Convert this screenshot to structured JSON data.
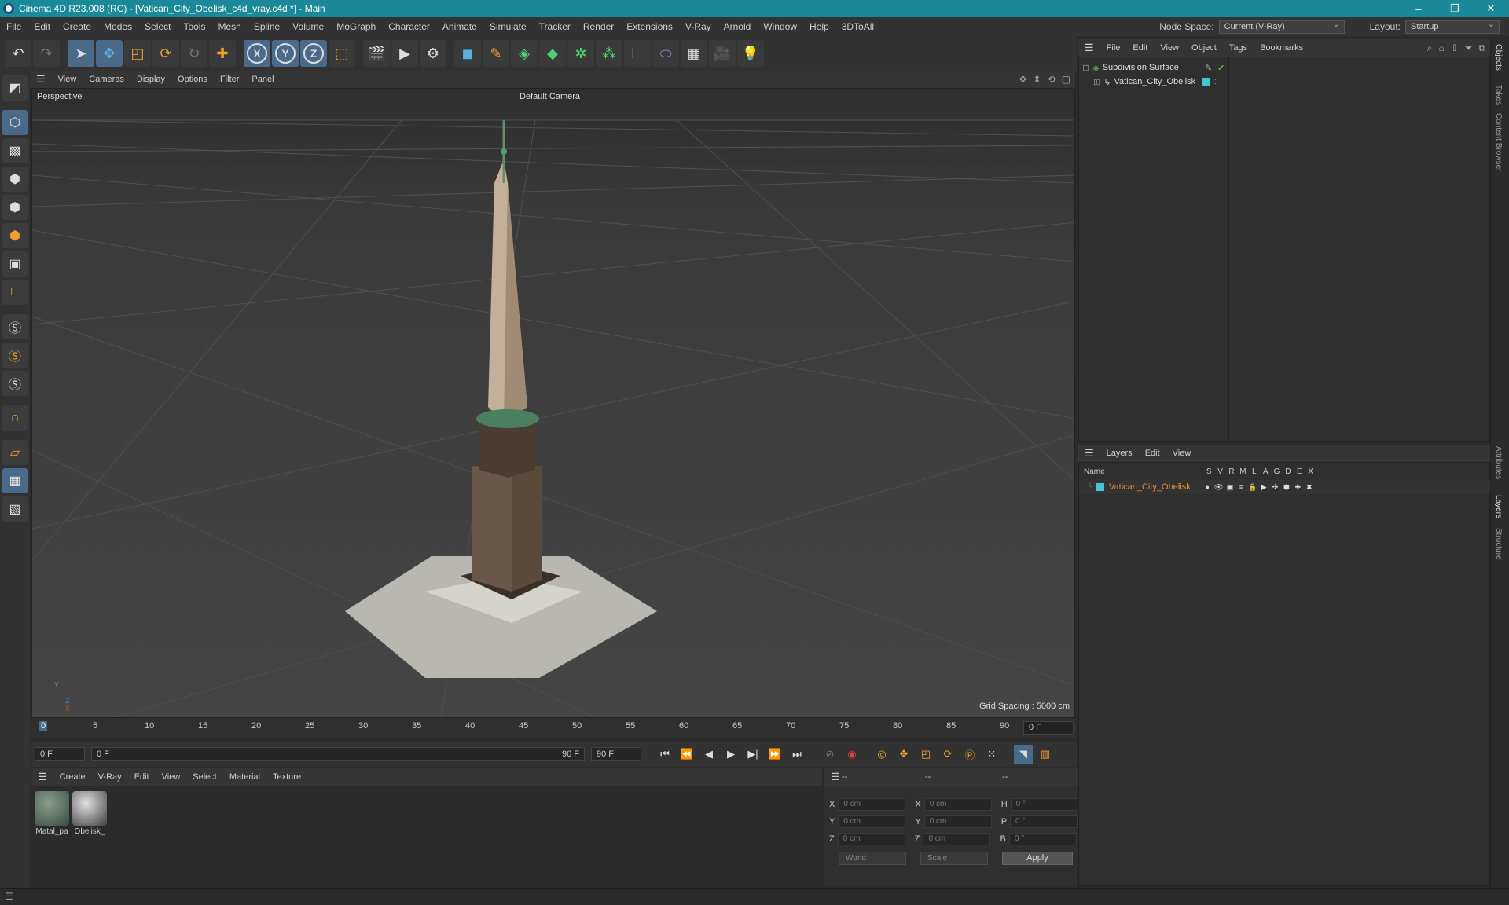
{
  "window": {
    "title": "Cinema 4D R23.008 (RC) - [Vatican_City_Obelisk_c4d_vray.c4d *] - Main",
    "controls": [
      "–",
      "❐",
      "✕"
    ]
  },
  "menubar": {
    "items": [
      "File",
      "Edit",
      "Create",
      "Modes",
      "Select",
      "Tools",
      "Mesh",
      "Spline",
      "Volume",
      "MoGraph",
      "Character",
      "Animate",
      "Simulate",
      "Tracker",
      "Render",
      "Extensions",
      "V-Ray",
      "Arnold",
      "Window",
      "Help",
      "3DToAll"
    ],
    "node_space_label": "Node Space:",
    "node_space_value": "Current (V-Ray)",
    "layout_label": "Layout:",
    "layout_value": "Startup"
  },
  "toolbar": {
    "axis_x": "X",
    "axis_y": "Y",
    "axis_z": "Z"
  },
  "viewport": {
    "menu": [
      "View",
      "Cameras",
      "Display",
      "Options",
      "Filter",
      "Panel"
    ],
    "label": "Perspective",
    "camera": "Default Camera",
    "grid_spacing": "Grid Spacing : 5000 cm",
    "axis_y": "Y",
    "axis_z": "Z",
    "axis_x": "X"
  },
  "timeline": {
    "ticks": [
      "0",
      "5",
      "10",
      "15",
      "20",
      "25",
      "30",
      "35",
      "40",
      "45",
      "50",
      "55",
      "60",
      "65",
      "70",
      "75",
      "80",
      "85",
      "90"
    ],
    "current_frame": "0 F"
  },
  "transport": {
    "start_field": "0 F",
    "range_start": "0 F",
    "range_end": "90 F",
    "end_field": "90 F"
  },
  "materials": {
    "menu": [
      "Create",
      "V-Ray",
      "Edit",
      "View",
      "Select",
      "Material",
      "Texture"
    ],
    "items": [
      {
        "name": "Matal_pa",
        "color": "#5a6a60"
      },
      {
        "name": "Obelisk_",
        "color": "#9a9a9a"
      }
    ]
  },
  "coordinates": {
    "header": [
      "--",
      "--",
      "--"
    ],
    "rows": [
      {
        "a": "X",
        "v1": "0 cm",
        "b": "X",
        "v2": "0 cm",
        "c": "H",
        "v3": "0 °"
      },
      {
        "a": "Y",
        "v1": "0 cm",
        "b": "Y",
        "v2": "0 cm",
        "c": "P",
        "v3": "0 °"
      },
      {
        "a": "Z",
        "v1": "0 cm",
        "b": "Z",
        "v2": "0 cm",
        "c": "B",
        "v3": "0 °"
      }
    ],
    "world": "World",
    "scale": "Scale",
    "apply": "Apply"
  },
  "objects": {
    "menu": [
      "File",
      "Edit",
      "View",
      "Object",
      "Tags",
      "Bookmarks"
    ],
    "items": [
      {
        "name": "Subdivision Surface",
        "color": "#50c050"
      },
      {
        "name": "Vatican_City_Obelisk",
        "color": "#40c8d8"
      }
    ]
  },
  "layers": {
    "menu": [
      "Layers",
      "Edit",
      "View"
    ],
    "columns": [
      "Name",
      "S",
      "V",
      "R",
      "M",
      "L",
      "A",
      "G",
      "D",
      "E",
      "X"
    ],
    "row": {
      "name": "Vatican_City_Obelisk",
      "color": "#40c8d8"
    }
  },
  "right_tabs": [
    "Objects",
    "Takes",
    "Content Browser",
    "Attributes",
    "Layers",
    "Structure"
  ],
  "colors": {
    "titlebar": "#1a8a9a",
    "accent_orange": "#f08c30"
  }
}
